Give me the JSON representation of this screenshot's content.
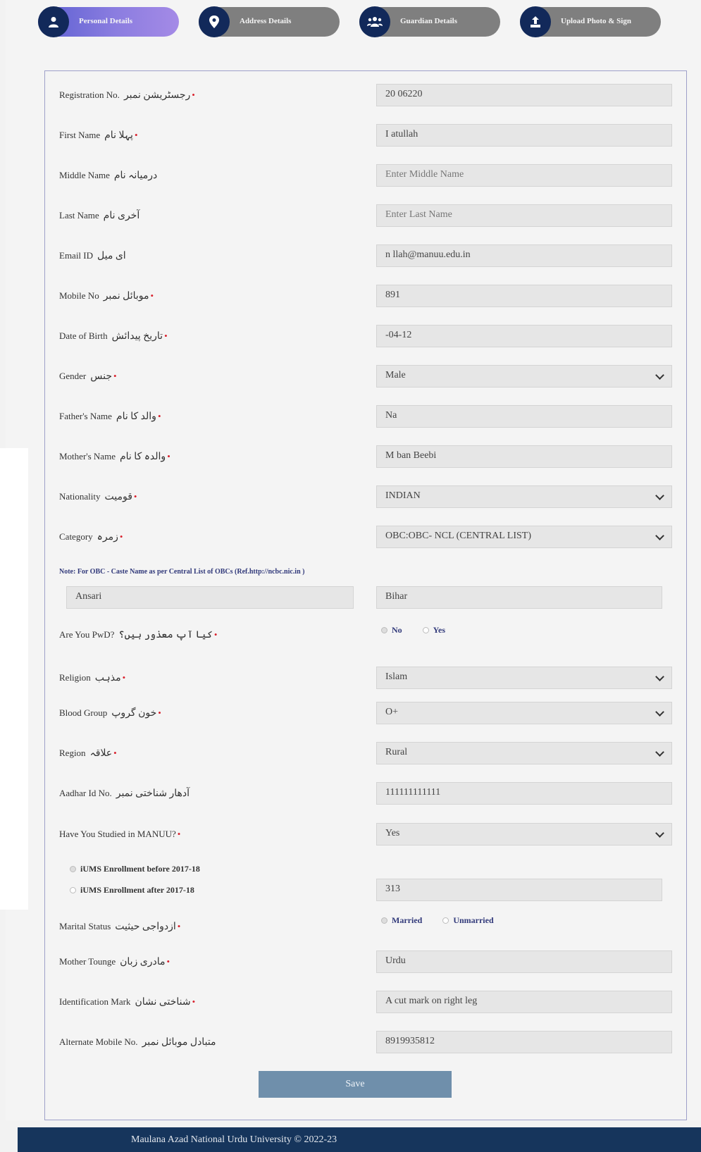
{
  "steps": [
    {
      "label": "Personal Details",
      "icon": "user-icon",
      "active": true
    },
    {
      "label": "Address Details",
      "icon": "map-pin-icon",
      "active": false
    },
    {
      "label": "Guardian Details",
      "icon": "users-icon",
      "active": false
    },
    {
      "label": "Upload Photo & Sign",
      "icon": "upload-icon",
      "active": false
    }
  ],
  "form": {
    "registration": {
      "label": "Registration No.",
      "urdu": "رجسٹریشن نمبر",
      "required": true,
      "value": "20   06220"
    },
    "first_name": {
      "label": "First Name",
      "urdu": "پہلا نام",
      "required": true,
      "value": "I      atullah"
    },
    "middle_name": {
      "label": "Middle Name",
      "urdu": "درمیانہ نام",
      "required": false,
      "placeholder": "Enter Middle Name"
    },
    "last_name": {
      "label": "Last Name",
      "urdu": "آخری نام",
      "required": false,
      "placeholder": "Enter Last Name"
    },
    "email": {
      "label": "Email ID",
      "urdu": "ای میل",
      "required": false,
      "value": "n           llah@manuu.edu.in"
    },
    "mobile": {
      "label": "Mobile No",
      "urdu": "موبائل نمبر",
      "required": true,
      "value": "891"
    },
    "dob": {
      "label": "Date of Birth",
      "urdu": "تاریخ پیدائش",
      "required": true,
      "value": "   -04-12"
    },
    "gender": {
      "label": "Gender",
      "urdu": "جنس",
      "required": true,
      "value": "Male"
    },
    "father": {
      "label": "Father's Name",
      "urdu": "والد کا نام",
      "required": true,
      "value": "Na"
    },
    "mother": {
      "label": "Mother's Name",
      "urdu": "والدہ کا نام",
      "required": true,
      "value": "M      ban Beebi"
    },
    "nationality": {
      "label": "Nationality",
      "urdu": "قومیت",
      "required": true,
      "value": "INDIAN"
    },
    "category": {
      "label": "Category",
      "urdu": "زمرہ",
      "required": true,
      "value": "OBC:OBC- NCL (CENTRAL LIST)"
    },
    "obc_note": "Note: For OBC - Caste Name as per Central List of OBCs (Ref.http://ncbc.nic.in )",
    "caste_name": "Ansari",
    "caste_state": "Bihar",
    "pwd": {
      "label": "Are You PwD?",
      "urdu": "کیا آپ معذور ہیں؟",
      "required": true,
      "options": [
        "No",
        "Yes"
      ],
      "selected": "No"
    },
    "religion": {
      "label": "Religion",
      "urdu": "مذہب",
      "required": true,
      "value": "Islam"
    },
    "blood_group": {
      "label": "Blood Group",
      "urdu": "خون گروپ",
      "required": true,
      "value": "O+"
    },
    "region": {
      "label": "Region",
      "urdu": "علاقہ",
      "required": true,
      "value": "Rural"
    },
    "aadhar": {
      "label": "Aadhar Id No.",
      "urdu": "آدھار شناختی نمبر",
      "required": false,
      "value": "111111111111"
    },
    "studied_manuu": {
      "label": "Have You Studied in MANUU?",
      "required": true,
      "value": "Yes"
    },
    "enroll_before": "iUMS Enrollment before 2017-18",
    "enroll_after": "iUMS Enrollment after 2017-18",
    "enroll_value": "      313",
    "marital": {
      "label": "Marital Status",
      "urdu": "ازدواجی حیثیت",
      "required": true,
      "options": [
        "Married",
        "Unmarried"
      ],
      "selected": "Married"
    },
    "mother_tongue": {
      "label": "Mother Tounge",
      "urdu": "مادری زبان",
      "required": true,
      "value": "Urdu"
    },
    "identification": {
      "label": "Identification Mark",
      "urdu": "شناختی نشان",
      "required": true,
      "value": "A cut mark on right leg"
    },
    "alt_mobile": {
      "label": "Alternate Mobile No.",
      "urdu": "متبادل موبائل نمبر",
      "required": false,
      "value": "8919935812"
    },
    "save_label": "Save"
  },
  "footer": {
    "text": "Maulana Azad National Urdu University © 2022-23"
  },
  "colors": {
    "tab_active": "#8b7de0",
    "tab_inactive": "#7f7f7f",
    "circle": "#12295a",
    "footer": "#16355c",
    "button": "#6f8fab",
    "required": "#d9232f"
  }
}
